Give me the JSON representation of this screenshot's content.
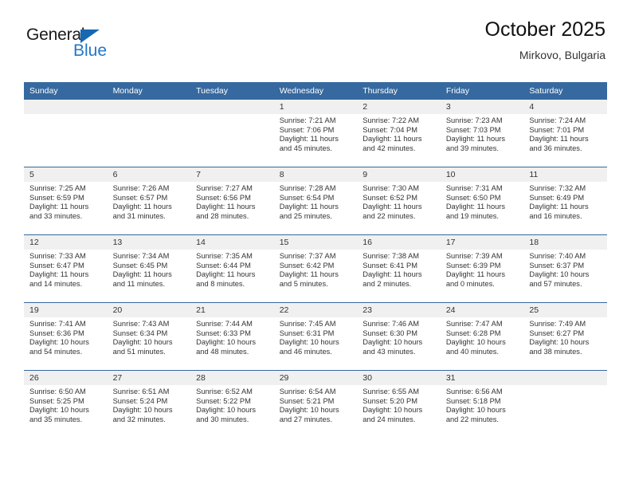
{
  "brand": {
    "name_top": "General",
    "name_bottom": "Blue",
    "triangle_color": "#1668b3"
  },
  "header": {
    "title": "October 2025",
    "subtitle": "Mirkovo, Bulgaria",
    "header_bg": "#36699f"
  },
  "weekdays": [
    "Sunday",
    "Monday",
    "Tuesday",
    "Wednesday",
    "Thursday",
    "Friday",
    "Saturday"
  ],
  "labels": {
    "sunrise": "Sunrise:",
    "sunset": "Sunset:",
    "daylight": "Daylight:"
  },
  "weeks": [
    [
      {
        "day": "",
        "sunrise": "",
        "sunset": "",
        "daylight_a": "",
        "daylight_b": ""
      },
      {
        "day": "",
        "sunrise": "",
        "sunset": "",
        "daylight_a": "",
        "daylight_b": ""
      },
      {
        "day": "",
        "sunrise": "",
        "sunset": "",
        "daylight_a": "",
        "daylight_b": ""
      },
      {
        "day": "1",
        "sunrise": "Sunrise: 7:21 AM",
        "sunset": "Sunset: 7:06 PM",
        "daylight_a": "Daylight: 11 hours",
        "daylight_b": "and 45 minutes."
      },
      {
        "day": "2",
        "sunrise": "Sunrise: 7:22 AM",
        "sunset": "Sunset: 7:04 PM",
        "daylight_a": "Daylight: 11 hours",
        "daylight_b": "and 42 minutes."
      },
      {
        "day": "3",
        "sunrise": "Sunrise: 7:23 AM",
        "sunset": "Sunset: 7:03 PM",
        "daylight_a": "Daylight: 11 hours",
        "daylight_b": "and 39 minutes."
      },
      {
        "day": "4",
        "sunrise": "Sunrise: 7:24 AM",
        "sunset": "Sunset: 7:01 PM",
        "daylight_a": "Daylight: 11 hours",
        "daylight_b": "and 36 minutes."
      }
    ],
    [
      {
        "day": "5",
        "sunrise": "Sunrise: 7:25 AM",
        "sunset": "Sunset: 6:59 PM",
        "daylight_a": "Daylight: 11 hours",
        "daylight_b": "and 33 minutes."
      },
      {
        "day": "6",
        "sunrise": "Sunrise: 7:26 AM",
        "sunset": "Sunset: 6:57 PM",
        "daylight_a": "Daylight: 11 hours",
        "daylight_b": "and 31 minutes."
      },
      {
        "day": "7",
        "sunrise": "Sunrise: 7:27 AM",
        "sunset": "Sunset: 6:56 PM",
        "daylight_a": "Daylight: 11 hours",
        "daylight_b": "and 28 minutes."
      },
      {
        "day": "8",
        "sunrise": "Sunrise: 7:28 AM",
        "sunset": "Sunset: 6:54 PM",
        "daylight_a": "Daylight: 11 hours",
        "daylight_b": "and 25 minutes."
      },
      {
        "day": "9",
        "sunrise": "Sunrise: 7:30 AM",
        "sunset": "Sunset: 6:52 PM",
        "daylight_a": "Daylight: 11 hours",
        "daylight_b": "and 22 minutes."
      },
      {
        "day": "10",
        "sunrise": "Sunrise: 7:31 AM",
        "sunset": "Sunset: 6:50 PM",
        "daylight_a": "Daylight: 11 hours",
        "daylight_b": "and 19 minutes."
      },
      {
        "day": "11",
        "sunrise": "Sunrise: 7:32 AM",
        "sunset": "Sunset: 6:49 PM",
        "daylight_a": "Daylight: 11 hours",
        "daylight_b": "and 16 minutes."
      }
    ],
    [
      {
        "day": "12",
        "sunrise": "Sunrise: 7:33 AM",
        "sunset": "Sunset: 6:47 PM",
        "daylight_a": "Daylight: 11 hours",
        "daylight_b": "and 14 minutes."
      },
      {
        "day": "13",
        "sunrise": "Sunrise: 7:34 AM",
        "sunset": "Sunset: 6:45 PM",
        "daylight_a": "Daylight: 11 hours",
        "daylight_b": "and 11 minutes."
      },
      {
        "day": "14",
        "sunrise": "Sunrise: 7:35 AM",
        "sunset": "Sunset: 6:44 PM",
        "daylight_a": "Daylight: 11 hours",
        "daylight_b": "and 8 minutes."
      },
      {
        "day": "15",
        "sunrise": "Sunrise: 7:37 AM",
        "sunset": "Sunset: 6:42 PM",
        "daylight_a": "Daylight: 11 hours",
        "daylight_b": "and 5 minutes."
      },
      {
        "day": "16",
        "sunrise": "Sunrise: 7:38 AM",
        "sunset": "Sunset: 6:41 PM",
        "daylight_a": "Daylight: 11 hours",
        "daylight_b": "and 2 minutes."
      },
      {
        "day": "17",
        "sunrise": "Sunrise: 7:39 AM",
        "sunset": "Sunset: 6:39 PM",
        "daylight_a": "Daylight: 11 hours",
        "daylight_b": "and 0 minutes."
      },
      {
        "day": "18",
        "sunrise": "Sunrise: 7:40 AM",
        "sunset": "Sunset: 6:37 PM",
        "daylight_a": "Daylight: 10 hours",
        "daylight_b": "and 57 minutes."
      }
    ],
    [
      {
        "day": "19",
        "sunrise": "Sunrise: 7:41 AM",
        "sunset": "Sunset: 6:36 PM",
        "daylight_a": "Daylight: 10 hours",
        "daylight_b": "and 54 minutes."
      },
      {
        "day": "20",
        "sunrise": "Sunrise: 7:43 AM",
        "sunset": "Sunset: 6:34 PM",
        "daylight_a": "Daylight: 10 hours",
        "daylight_b": "and 51 minutes."
      },
      {
        "day": "21",
        "sunrise": "Sunrise: 7:44 AM",
        "sunset": "Sunset: 6:33 PM",
        "daylight_a": "Daylight: 10 hours",
        "daylight_b": "and 48 minutes."
      },
      {
        "day": "22",
        "sunrise": "Sunrise: 7:45 AM",
        "sunset": "Sunset: 6:31 PM",
        "daylight_a": "Daylight: 10 hours",
        "daylight_b": "and 46 minutes."
      },
      {
        "day": "23",
        "sunrise": "Sunrise: 7:46 AM",
        "sunset": "Sunset: 6:30 PM",
        "daylight_a": "Daylight: 10 hours",
        "daylight_b": "and 43 minutes."
      },
      {
        "day": "24",
        "sunrise": "Sunrise: 7:47 AM",
        "sunset": "Sunset: 6:28 PM",
        "daylight_a": "Daylight: 10 hours",
        "daylight_b": "and 40 minutes."
      },
      {
        "day": "25",
        "sunrise": "Sunrise: 7:49 AM",
        "sunset": "Sunset: 6:27 PM",
        "daylight_a": "Daylight: 10 hours",
        "daylight_b": "and 38 minutes."
      }
    ],
    [
      {
        "day": "26",
        "sunrise": "Sunrise: 6:50 AM",
        "sunset": "Sunset: 5:25 PM",
        "daylight_a": "Daylight: 10 hours",
        "daylight_b": "and 35 minutes."
      },
      {
        "day": "27",
        "sunrise": "Sunrise: 6:51 AM",
        "sunset": "Sunset: 5:24 PM",
        "daylight_a": "Daylight: 10 hours",
        "daylight_b": "and 32 minutes."
      },
      {
        "day": "28",
        "sunrise": "Sunrise: 6:52 AM",
        "sunset": "Sunset: 5:22 PM",
        "daylight_a": "Daylight: 10 hours",
        "daylight_b": "and 30 minutes."
      },
      {
        "day": "29",
        "sunrise": "Sunrise: 6:54 AM",
        "sunset": "Sunset: 5:21 PM",
        "daylight_a": "Daylight: 10 hours",
        "daylight_b": "and 27 minutes."
      },
      {
        "day": "30",
        "sunrise": "Sunrise: 6:55 AM",
        "sunset": "Sunset: 5:20 PM",
        "daylight_a": "Daylight: 10 hours",
        "daylight_b": "and 24 minutes."
      },
      {
        "day": "31",
        "sunrise": "Sunrise: 6:56 AM",
        "sunset": "Sunset: 5:18 PM",
        "daylight_a": "Daylight: 10 hours",
        "daylight_b": "and 22 minutes."
      },
      {
        "day": "",
        "sunrise": "",
        "sunset": "",
        "daylight_a": "",
        "daylight_b": ""
      }
    ]
  ]
}
